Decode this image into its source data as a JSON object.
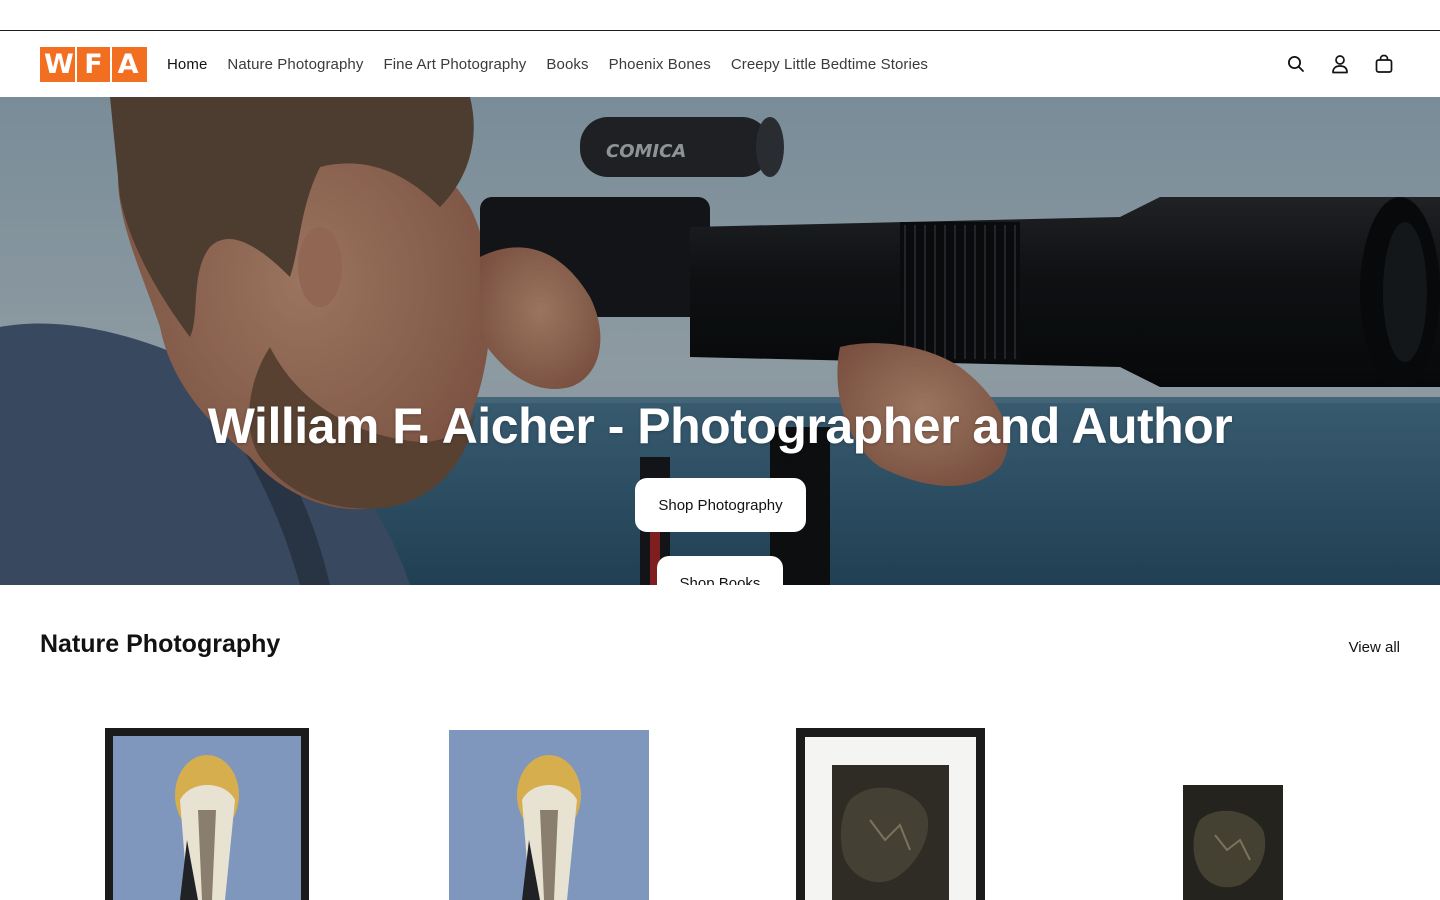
{
  "logo": {
    "letters": [
      "W",
      "F",
      "A"
    ],
    "color": "#f26f21"
  },
  "nav": {
    "items": [
      {
        "label": "Home",
        "active": true
      },
      {
        "label": "Nature Photography"
      },
      {
        "label": "Fine Art Photography"
      },
      {
        "label": "Books"
      },
      {
        "label": "Phoenix Bones"
      },
      {
        "label": "Creepy Little Bedtime Stories"
      }
    ]
  },
  "header_icons": [
    "search-icon",
    "account-icon",
    "cart-icon"
  ],
  "hero": {
    "title": "William F. Aicher - Photographer and Author",
    "primary_button": "Shop Photography",
    "secondary_button": "Shop Books",
    "lens_brand": "COMICA"
  },
  "collection": {
    "title": "Nature Photography",
    "view_all": "View all"
  }
}
